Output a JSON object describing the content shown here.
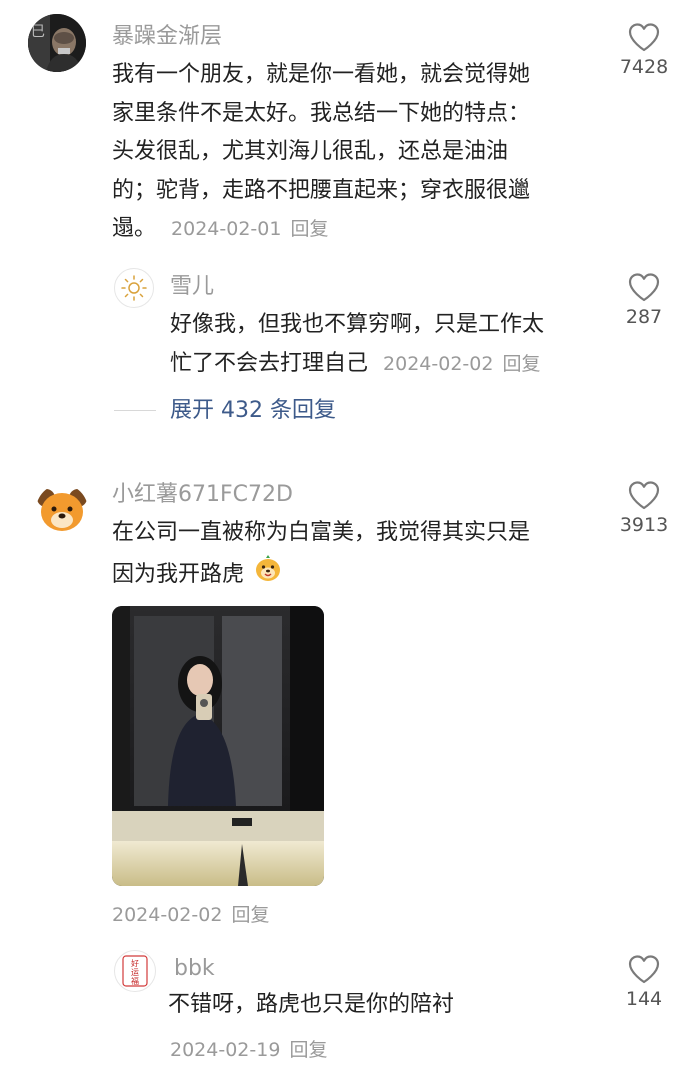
{
  "comments": [
    {
      "username": "暴躁金渐层",
      "text": "我有一个朋友，就是你一看她，就会觉得她家里条件不是太好。我总结一下她的特点：头发很乱，尤其刘海儿很乱，还总是油油的；驼背，走路不把腰直起来；穿衣服很邋遢。",
      "lines": [
        "我有一个朋友，就是你一看她，就会觉得她",
        "家里条件不是太好。我总结一下她的特点：",
        "头发很乱，尤其刘海儿很乱，还总是油油",
        "的；驼背，走路不把腰直起来；穿衣服很邋",
        "遢。"
      ],
      "date": "2024-02-01",
      "reply_label": "回复",
      "likes": "7428",
      "replies": [
        {
          "username": "雪儿",
          "lines": [
            "好像我，但我也不算穷啊，只是工作太",
            "忙了不会去打理自己"
          ],
          "date": "2024-02-02",
          "reply_label": "回复",
          "likes": "287"
        }
      ],
      "expand_label": "展开 432 条回复"
    },
    {
      "username": "小红薯671FC72D",
      "lines": [
        "在公司一直被称为白富美，我觉得其实只是",
        "因为我开路虎"
      ],
      "date": "2024-02-02",
      "reply_label": "回复",
      "likes": "3913",
      "replies": [
        {
          "username": "bbk",
          "avatar_text": "好运福",
          "lines": [
            "不错呀，路虎也只是你的陪衬"
          ],
          "date": "2024-02-19",
          "reply_label": "回复",
          "likes": "144"
        }
      ]
    }
  ],
  "icons": {
    "like": "heart-outline-icon",
    "emoji": "dog-emoji-icon",
    "sun": "sun-icon"
  },
  "colors": {
    "meta": "#9a9a9a",
    "link": "#3d5a8a",
    "text": "#222222"
  }
}
